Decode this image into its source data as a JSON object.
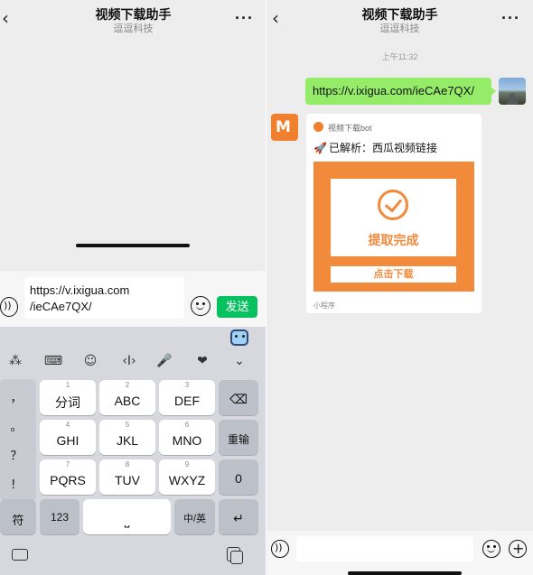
{
  "left": {
    "header": {
      "back_glyph": "‹",
      "title": "视频下载助手",
      "subtitle": "逗逗科技",
      "more_glyph": "···"
    },
    "input": {
      "text_line1": "https://v.ixigua.com",
      "text_line2": "/ieCAe7QX/",
      "send_label": "发送"
    },
    "keyboard": {
      "toolbar_glyphs": [
        "⁂",
        "⌨",
        "☺",
        "‹I›",
        "🎤",
        "❤",
        "⌄"
      ],
      "side_punct": [
        "，",
        "。",
        "？",
        "！"
      ],
      "keys": [
        {
          "num": "1",
          "label": "分词"
        },
        {
          "num": "2",
          "label": "ABC"
        },
        {
          "num": "3",
          "label": "DEF"
        },
        {
          "num": "4",
          "label": "GHI"
        },
        {
          "num": "5",
          "label": "JKL"
        },
        {
          "num": "6",
          "label": "MNO"
        },
        {
          "num": "7",
          "label": "PQRS"
        },
        {
          "num": "8",
          "label": "TUV"
        },
        {
          "num": "9",
          "label": "WXYZ"
        }
      ],
      "delete_glyph": "⌫",
      "retype_label": "重输",
      "zero_label": "0",
      "symbol_label": "符",
      "num_label": "123",
      "space_glyph": "⎵",
      "lang_label": "中/英",
      "enter_glyph": "↵"
    }
  },
  "right": {
    "header": {
      "back_glyph": "‹",
      "title": "视频下载助手",
      "subtitle": "逗逗科技",
      "more_glyph": "···"
    },
    "timestamp": "上午11:32",
    "outgoing_message": "https://v.ixigua.com/ieCAe7QX/",
    "card": {
      "source": "视频下载bot",
      "title": "已解析：西瓜视频链接",
      "rocket_glyph": "🚀",
      "status": "提取完成",
      "button": "点击下载",
      "footer": "小程序"
    },
    "bot_avatar_glyph": "M"
  },
  "colors": {
    "accent_green": "#07c160",
    "bubble_green": "#95ec69",
    "brand_orange": "#f28a3c",
    "background": "#ededed"
  }
}
